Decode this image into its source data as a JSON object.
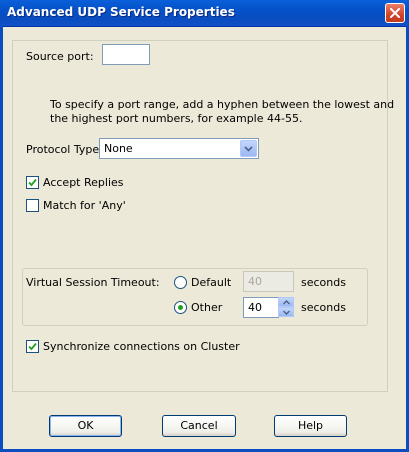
{
  "window": {
    "title": "Advanced UDP Service Properties"
  },
  "source_port": {
    "label": "Source port:",
    "value": ""
  },
  "hint": {
    "line1": "To specify a port range, add a hyphen between the lowest and",
    "line2": "the highest port numbers, for example 44-55."
  },
  "protocol": {
    "label": "Protocol Type:",
    "selected": "None"
  },
  "accept_replies": {
    "label": "Accept Replies",
    "checked": true
  },
  "match_any": {
    "label": "Match for 'Any'",
    "checked": false
  },
  "timeout": {
    "label": "Virtual Session Timeout:",
    "default_label": "Default",
    "default_value": "40",
    "other_label": "Other",
    "other_value": "40",
    "unit": "seconds",
    "selected": "Other"
  },
  "sync": {
    "label": "Synchronize connections on Cluster",
    "checked": true
  },
  "buttons": {
    "ok": "OK",
    "cancel": "Cancel",
    "help": "Help"
  },
  "icons": {
    "close": "close-icon",
    "dropdown": "chevron-down-icon",
    "check": "check-icon",
    "spin_up": "spin-up-icon",
    "spin_down": "spin-down-icon"
  },
  "colors": {
    "titlebar": "#0451c9",
    "dialog_bg": "#ece9d8",
    "close_button": "#d2452a",
    "check": "#21a121"
  }
}
